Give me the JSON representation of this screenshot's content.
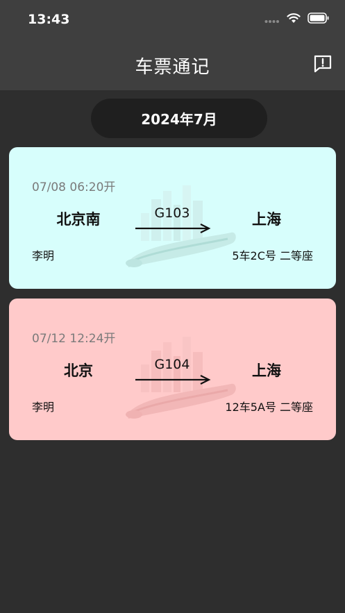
{
  "status_bar": {
    "time": "13:43",
    "icons": [
      "signal-dots-icon",
      "wifi-icon",
      "battery-icon"
    ]
  },
  "nav": {
    "title": "车票通记",
    "feedback_icon": "feedback-icon"
  },
  "month_selector": {
    "label": "2024年7月"
  },
  "tickets": [
    {
      "depart_time": "07/08 06:20开",
      "from": "北京南",
      "train_no": "G103",
      "to": "上海",
      "passenger": "李明",
      "seat": "5车2C号 二等座",
      "bg_color": "#d7fefc"
    },
    {
      "depart_time": "07/12 12:24开",
      "from": "北京",
      "train_no": "G104",
      "to": "上海",
      "passenger": "李明",
      "seat": "12车5A号 二等座",
      "bg_color": "#ffcaca"
    }
  ]
}
